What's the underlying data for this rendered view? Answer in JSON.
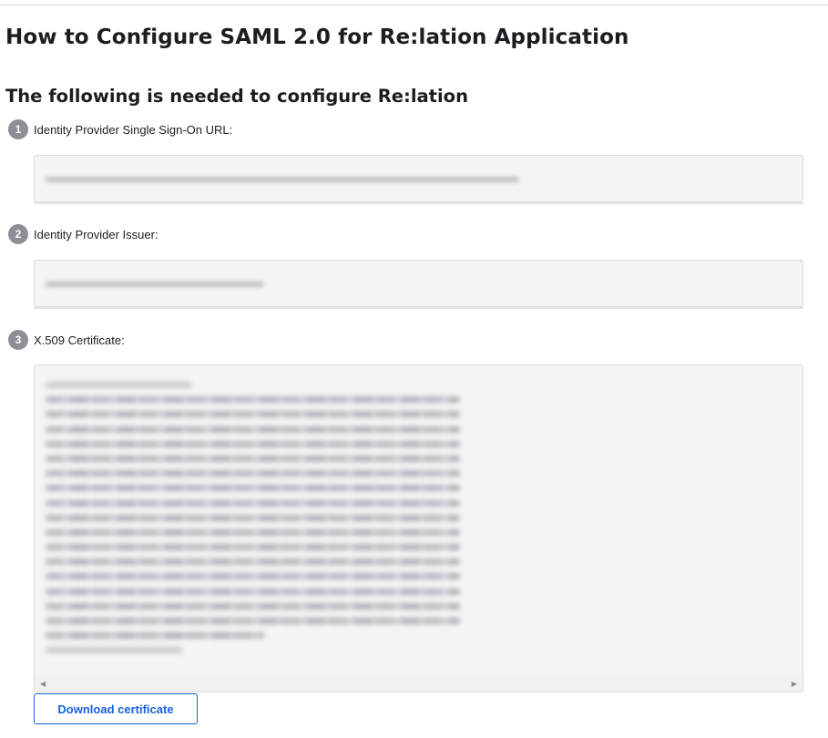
{
  "page": {
    "title": "How to Configure SAML 2.0 for Re:lation Application",
    "subtitle": "The following is needed to configure Re:lation"
  },
  "steps": [
    {
      "number": "1",
      "label": "Identity Provider Single Sign-On URL:"
    },
    {
      "number": "2",
      "label": "Identity Provider Issuer:"
    },
    {
      "number": "3",
      "label": "X.509 Certificate:"
    }
  ],
  "download_button": {
    "label": "Download certificate"
  },
  "colors": {
    "accent": "#1662dd",
    "step_badge": "#8e8e96",
    "field_bg": "#f4f4f4"
  },
  "icons": {
    "scroll_left": "scroll-left-arrow-icon",
    "scroll_right": "scroll-right-arrow-icon"
  }
}
